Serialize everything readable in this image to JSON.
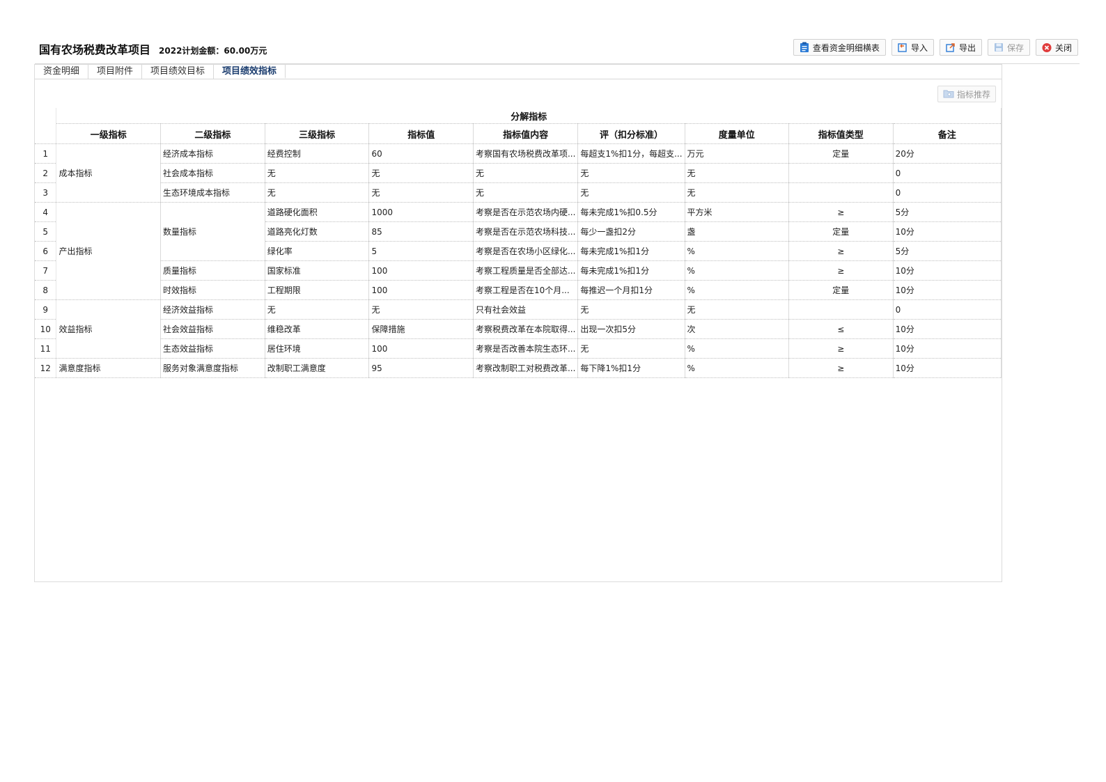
{
  "header": {
    "title": "国有农场税费改革项目",
    "plan_amount": "2022计划金额：60.00万元"
  },
  "toolbar": {
    "view_detail": "查看资金明细横表",
    "import": "导入",
    "export": "导出",
    "save": "保存",
    "close": "关闭"
  },
  "tabs": [
    {
      "label": "资金明细"
    },
    {
      "label": "项目附件"
    },
    {
      "label": "项目绩效目标"
    },
    {
      "label": "项目绩效指标",
      "active": true
    }
  ],
  "recommend_label": "指标推荐",
  "table": {
    "group_header": "分解指标",
    "columns": [
      "一级指标",
      "二级指标",
      "三级指标",
      "指标值",
      "指标值内容",
      "评（扣分标准）",
      "度量单位",
      "指标值类型",
      "备注"
    ],
    "rows": [
      {
        "n": "1",
        "l1": "成本指标",
        "l2": "经济成本指标",
        "l3": "经费控制",
        "value": "60",
        "content": "考察国有农场税费改革项...",
        "score": "每超支1%扣1分，每超支...",
        "unit": "万元",
        "type": "定量",
        "note": "20分"
      },
      {
        "n": "2",
        "l1": "",
        "l2": "社会成本指标",
        "l3": "无",
        "value": "无",
        "content": "无",
        "score": "无",
        "unit": "无",
        "type": "",
        "note": "0"
      },
      {
        "n": "3",
        "l1": "",
        "l2": "生态环境成本指标",
        "l3": "无",
        "value": "无",
        "content": "无",
        "score": "无",
        "unit": "无",
        "type": "",
        "note": "0"
      },
      {
        "n": "4",
        "l1": "产出指标",
        "l2": "数量指标",
        "l3": "道路硬化面积",
        "value": "1000",
        "content": "考察是否在示范农场内硬...",
        "score": "每未完成1%扣0.5分",
        "unit": "平方米",
        "type": "≥",
        "note": "5分"
      },
      {
        "n": "5",
        "l1": "",
        "l2": "",
        "l3": "道路亮化灯数",
        "value": "85",
        "content": "考察是否在示范农场科技...",
        "score": "每少一盏扣2分",
        "unit": "盏",
        "type": "定量",
        "note": "10分"
      },
      {
        "n": "6",
        "l1": "",
        "l2": "",
        "l3": "绿化率",
        "value": "5",
        "content": "考察是否在农场小区绿化...",
        "score": "每未完成1%扣1分",
        "unit": "%",
        "type": "≥",
        "note": "5分"
      },
      {
        "n": "7",
        "l1": "",
        "l2": "质量指标",
        "l3": "国家标准",
        "value": "100",
        "content": "考察工程质量是否全部达...",
        "score": "每未完成1%扣1分",
        "unit": "%",
        "type": "≥",
        "note": "10分"
      },
      {
        "n": "8",
        "l1": "",
        "l2": "时效指标",
        "l3": "工程期限",
        "value": "100",
        "content": "考察工程是否在10个月...",
        "score": "每推迟一个月扣1分",
        "unit": "%",
        "type": "定量",
        "note": "10分"
      },
      {
        "n": "9",
        "l1": "效益指标",
        "l2": "经济效益指标",
        "l3": "无",
        "value": "无",
        "content": "只有社会效益",
        "score": "无",
        "unit": "无",
        "type": "",
        "note": "0"
      },
      {
        "n": "10",
        "l1": "",
        "l2": "社会效益指标",
        "l3": "维稳改革",
        "value": "保障措施",
        "content": "考察税费改革在本院取得...",
        "score": "出现一次扣5分",
        "unit": "次",
        "type": "≤",
        "note": "10分"
      },
      {
        "n": "11",
        "l1": "",
        "l2": "生态效益指标",
        "l3": "居住环境",
        "value": "100",
        "content": "考察是否改善本院生态环...",
        "score": "无",
        "unit": "%",
        "type": "≥",
        "note": "10分"
      },
      {
        "n": "12",
        "l1": "满意度指标",
        "l2": "服务对象满意度指标",
        "l3": "改制职工满意度",
        "value": "95",
        "content": "考察改制职工对税费改革...",
        "score": "每下降1%扣1分",
        "unit": "%",
        "type": "≥",
        "note": "10分"
      }
    ]
  }
}
